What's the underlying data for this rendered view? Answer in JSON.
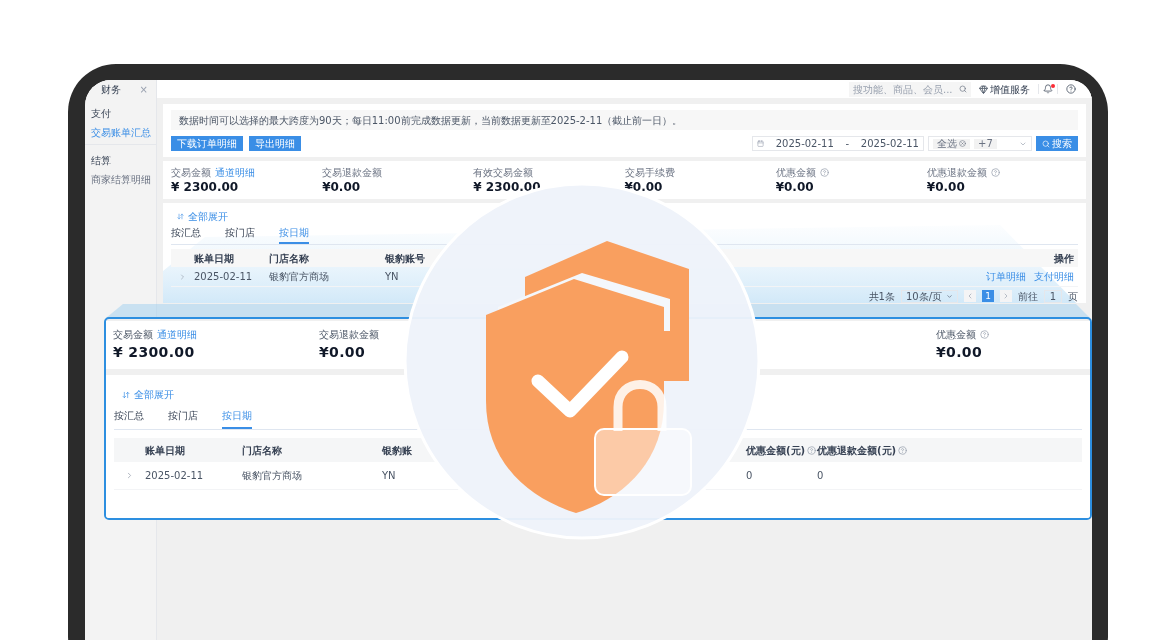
{
  "screen": {
    "sidebar": {
      "tab": {
        "label": "财务",
        "close": "×"
      },
      "groups": [
        {
          "title": "支付",
          "items": [
            {
              "label": "交易账单汇总",
              "selected": true
            }
          ]
        },
        {
          "title": "结算",
          "items": [
            {
              "label": "商家结算明细",
              "selected": false
            }
          ]
        }
      ]
    },
    "topbar": {
      "search_placeholder": "搜功能、商品、会员...",
      "value_added": "增值服务",
      "notification_dot": true
    },
    "notice": "数据时间可以选择的最大跨度为90天；每日11:00前完成数据更新，当前数据更新至2025-2-11（截止前一日）。",
    "actions": [
      "下载订单明细",
      "导出明细"
    ],
    "filters": {
      "date_start": "2025-02-11",
      "date_separator": "-",
      "date_end": "2025-02-11",
      "tags": [
        {
          "label": "全选",
          "removable": true
        },
        {
          "label": "+7",
          "removable": false
        }
      ],
      "search_button": "搜索"
    },
    "stats": [
      {
        "label": "交易金额",
        "link": "通道明细",
        "value": "¥ 2300.00",
        "info": false
      },
      {
        "label": "交易退款金额",
        "value": "¥0.00",
        "info": false
      },
      {
        "label": "有效交易金额",
        "value": "¥ 2300.00",
        "info": false
      },
      {
        "label": "交易手续费",
        "value": "¥0.00",
        "info": false
      },
      {
        "label": "优惠金额",
        "value": "¥0.00",
        "info": true
      },
      {
        "label": "优惠退款金额",
        "value": "¥0.00",
        "info": true
      }
    ],
    "expand_all": "全部展开",
    "tabs": [
      {
        "label": "按汇总",
        "selected": false
      },
      {
        "label": "按门店",
        "selected": false
      },
      {
        "label": "按日期",
        "selected": true
      }
    ],
    "table": {
      "columns": [
        "账单日期",
        "门店名称",
        "银豹账号"
      ],
      "action_column": "操作",
      "rows": [
        {
          "cells": [
            "2025-02-11",
            "银豹官方商场",
            "YN"
          ],
          "actions": [
            "订单明细",
            "支付明细"
          ]
        }
      ]
    },
    "pagination": {
      "total": "共1条",
      "page_size": "10条/页",
      "pages": [
        {
          "label": "1",
          "selected": true
        }
      ],
      "goto_label": "前往",
      "goto_value": "1",
      "page_unit": "页"
    }
  },
  "magnifier": {
    "stats": [
      {
        "label": "交易金额",
        "link": "通道明细",
        "value": "¥ 2300.00",
        "info": false
      },
      {
        "label": "交易退款金额",
        "value": "¥0.00",
        "info": false
      },
      {
        "label": "优惠金额",
        "value": "¥0.00",
        "info": true
      }
    ],
    "expand_all": "全部展开",
    "tabs": [
      {
        "label": "按汇总",
        "selected": false
      },
      {
        "label": "按门店",
        "selected": false
      },
      {
        "label": "按日期",
        "selected": true
      }
    ],
    "table": {
      "columns": [
        "账单日期",
        "门店名称",
        "银豹账"
      ],
      "right_columns": [
        {
          "label": "优惠金额(元)",
          "info": true
        },
        {
          "label": "优惠退款金额(元)",
          "info": true
        }
      ],
      "rows": [
        {
          "cells": [
            "2025-02-11",
            "银豹官方商场",
            "YN"
          ],
          "right_cells": [
            "0",
            "0"
          ]
        }
      ]
    }
  }
}
